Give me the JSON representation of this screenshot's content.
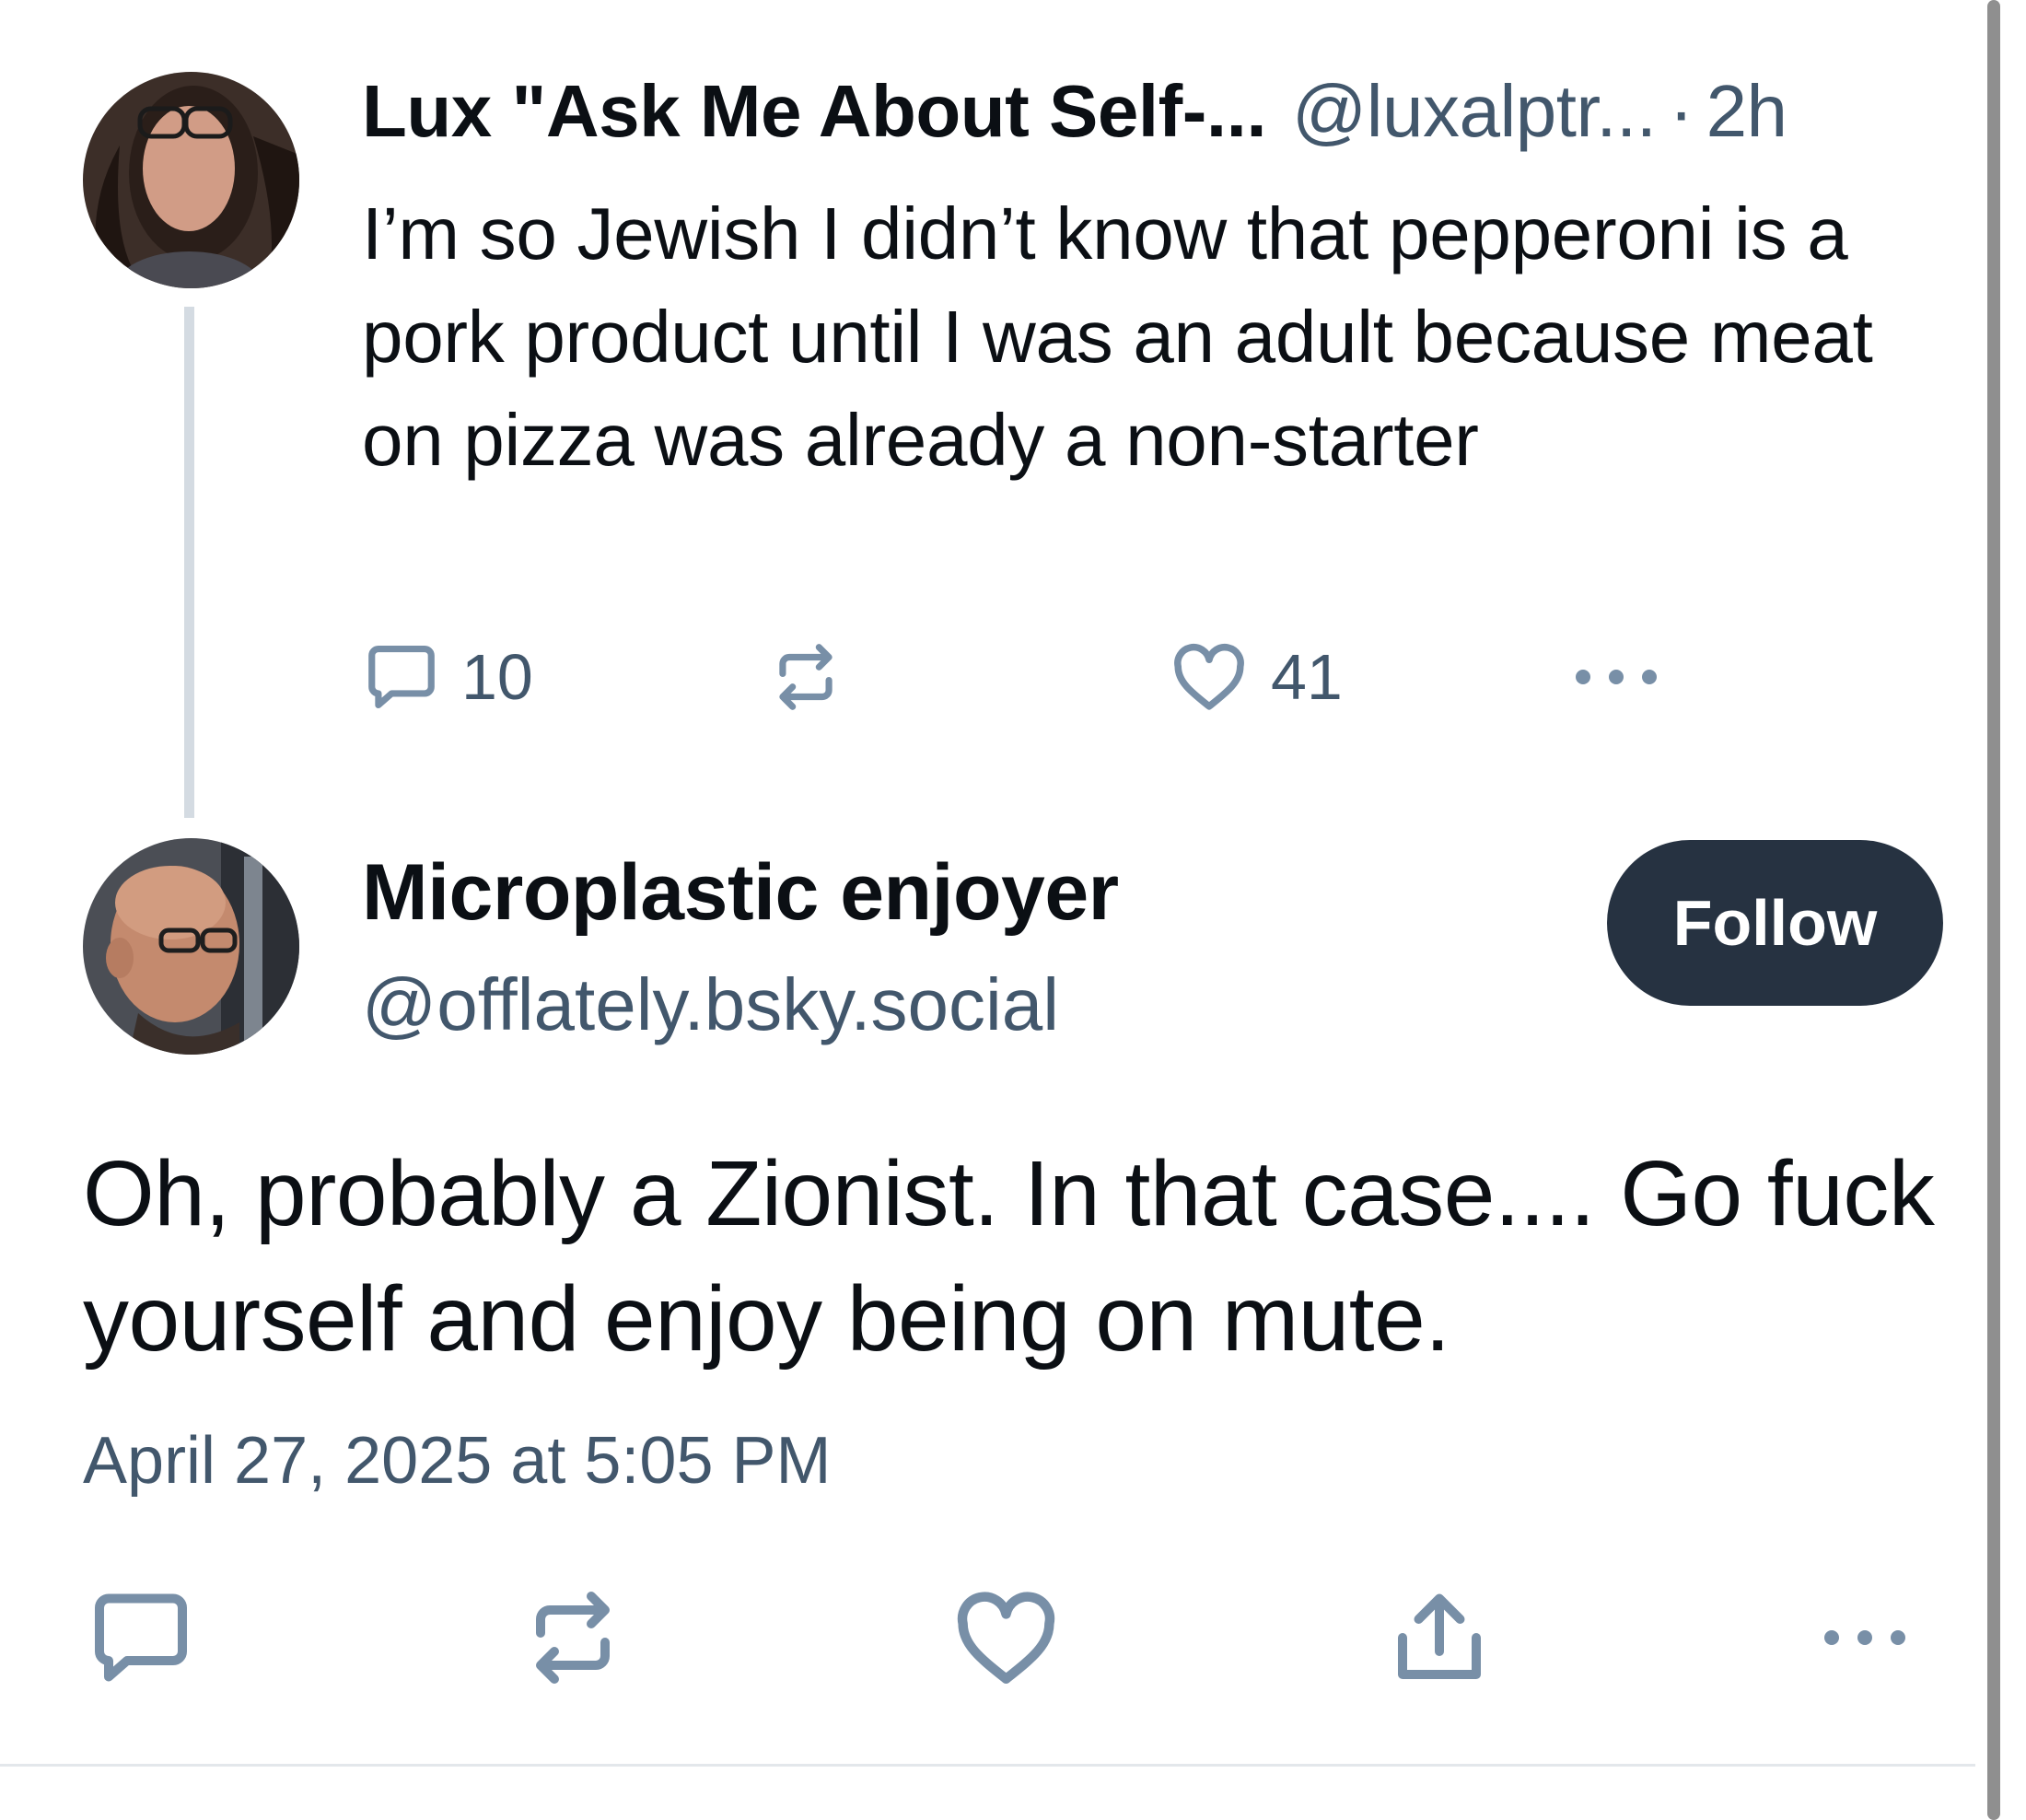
{
  "parent_post": {
    "author_name": "Lux \"Ask Me About Self-...",
    "author_handle": "@luxalptr...",
    "separator": "·",
    "time_ago": "2h",
    "text": "I’m so Jewish I didn’t know that pepperoni is a pork product until I was an adult because meat on pizza was already a non-starter",
    "reply_count": "10",
    "like_count": "41",
    "avatar_icon": "person-avatar-icon"
  },
  "reply_post": {
    "author_name": "Microplastic enjoyer",
    "author_handle": "@offlately.bsky.social",
    "follow_label": "Follow",
    "text": "Oh, probably a Zionist. In that case.... Go fuck yourself and enjoy being on mute.",
    "timestamp": "April 27, 2025 at 5:05 PM",
    "avatar_icon": "person-avatar-icon"
  },
  "icons": {
    "reply": "speech-bubble-icon",
    "repost": "repost-arrows-icon",
    "like": "heart-icon",
    "share": "share-upload-icon",
    "more": "ellipsis-icon"
  },
  "colors": {
    "text": "#0b0f14",
    "muted": "#42576c",
    "icon": "#788fa7",
    "follow_bg": "#263241",
    "thread_line": "#d4dbe2"
  }
}
